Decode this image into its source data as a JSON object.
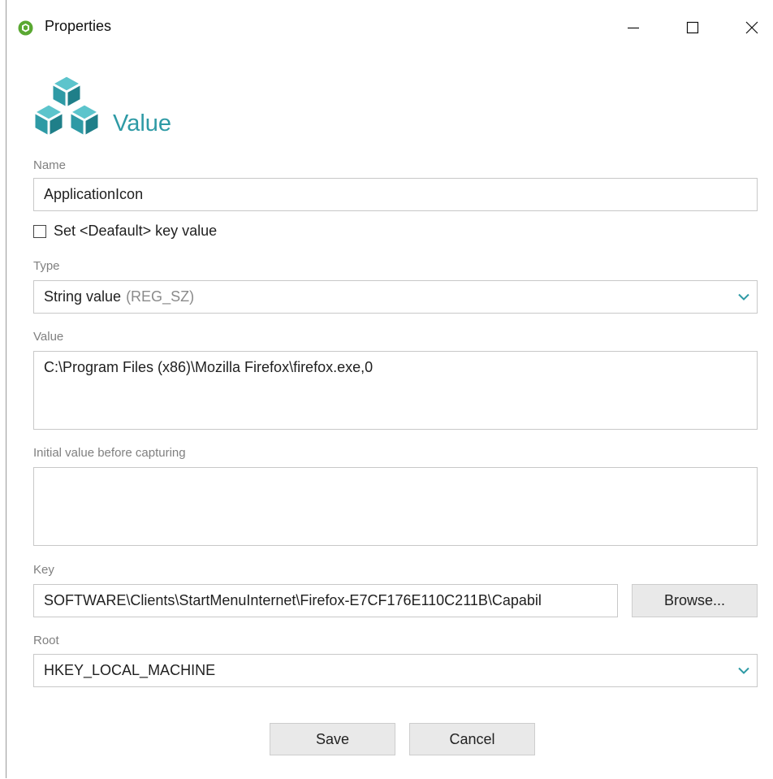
{
  "window": {
    "title": "Properties",
    "app_icon": "registry-app-icon"
  },
  "header": {
    "icon": "cubes-icon",
    "title": "Value",
    "accent_color": "#2e9aa5"
  },
  "form": {
    "name_label": "Name",
    "name_value": "ApplicationIcon",
    "default_checkbox_label": "Set <Deafault> key value",
    "default_checkbox_checked": false,
    "type_label": "Type",
    "type_value": "String value",
    "type_value_hint": "(REG_SZ)",
    "value_label": "Value",
    "value_value": "C:\\Program Files (x86)\\Mozilla Firefox\\firefox.exe,0",
    "initial_label": "Initial value before capturing",
    "initial_value": "",
    "key_label": "Key",
    "key_value": "SOFTWARE\\Clients\\StartMenuInternet\\Firefox-E7CF176E110C211B\\Capabil",
    "browse_label": "Browse...",
    "root_label": "Root",
    "root_value": "HKEY_LOCAL_MACHINE"
  },
  "footer": {
    "save_label": "Save",
    "cancel_label": "Cancel"
  }
}
